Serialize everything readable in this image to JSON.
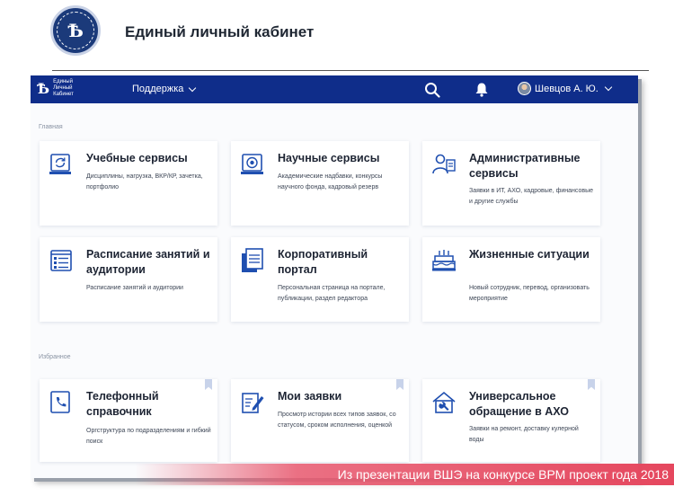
{
  "slide": {
    "title": "Единый личный кабинет"
  },
  "app": {
    "brand_text": "Единый Личный Кабинет",
    "brand_mark": "Ѣ",
    "nav_support": "Поддержка",
    "user_name": "Шевцов А. Ю."
  },
  "sections": {
    "main": "Главная",
    "favorites": "Избранное"
  },
  "cards": [
    {
      "title": "Учебные сервисы",
      "desc": "Дисциплины, нагрузка, ВКР/КР, зачетка, портфолио",
      "icon": "refresh-doc-icon"
    },
    {
      "title": "Научные сервисы",
      "desc": "Академические надбавки, конкурсы научного фонда, кадровый резерв",
      "icon": "science-target-icon"
    },
    {
      "title": "Административные сервисы",
      "desc": "Заявки в ИТ, АХО, кадровые, финансовые и другие службы",
      "icon": "admin-people-icon"
    },
    {
      "title": "Расписание занятий и аудитории",
      "desc": "Расписание занятий и аудитории",
      "icon": "schedule-list-icon"
    },
    {
      "title": "Корпоративный портал",
      "desc": "Персональная страница на портале, публикации, раздел редактора",
      "icon": "portal-document-icon"
    },
    {
      "title": "Жизненные ситуации",
      "desc": "Новый сотрудник, перевод, организовать мероприятие",
      "icon": "cake-icon"
    },
    {
      "title": "Телефонный справочник",
      "desc": "Оргструктура по подразделениям и гибкий поиск",
      "icon": "phone-book-icon"
    },
    {
      "title": "Мои заявки",
      "desc": "Просмотр истории всех типов заявок, со статусом, сроком исполнения, оценкой",
      "icon": "edit-document-icon"
    },
    {
      "title": "Универсальное обращение в АХО",
      "desc": "Заявки на ремонт, доставку кулерной воды",
      "icon": "maintenance-house-icon"
    }
  ],
  "watermark": "Из презентации ВШЭ на конкурсе ВРМ проект года 2018",
  "colors": {
    "topbar": "#0f2d8a",
    "accent": "#1f4fb0",
    "watermark": "#e5475e"
  }
}
